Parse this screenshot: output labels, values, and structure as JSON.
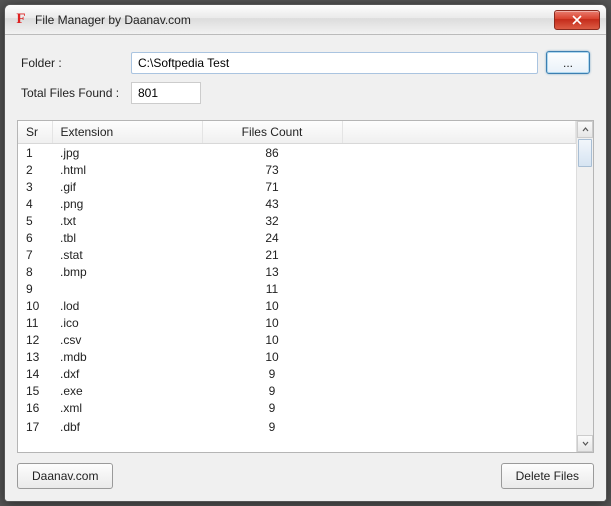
{
  "window": {
    "title": "File Manager by Daanav.com"
  },
  "form": {
    "folder_label": "Folder :",
    "folder_value": "C:\\Softpedia Test",
    "total_label": "Total Files Found :",
    "total_value": "801",
    "browse_label": "..."
  },
  "table": {
    "headers": {
      "sr": "Sr",
      "ext": "Extension",
      "count": "Files Count"
    },
    "rows": [
      {
        "sr": "1",
        "ext": ".jpg",
        "count": "86"
      },
      {
        "sr": "2",
        "ext": ".html",
        "count": "73"
      },
      {
        "sr": "3",
        "ext": ".gif",
        "count": "71"
      },
      {
        "sr": "4",
        "ext": ".png",
        "count": "43"
      },
      {
        "sr": "5",
        "ext": ".txt",
        "count": "32"
      },
      {
        "sr": "6",
        "ext": ".tbl",
        "count": "24"
      },
      {
        "sr": "7",
        "ext": ".stat",
        "count": "21"
      },
      {
        "sr": "8",
        "ext": ".bmp",
        "count": "13"
      },
      {
        "sr": "9",
        "ext": "",
        "count": "11"
      },
      {
        "sr": "10",
        "ext": ".lod",
        "count": "10"
      },
      {
        "sr": "11",
        "ext": ".ico",
        "count": "10"
      },
      {
        "sr": "12",
        "ext": ".csv",
        "count": "10"
      },
      {
        "sr": "13",
        "ext": ".mdb",
        "count": "10"
      },
      {
        "sr": "14",
        "ext": ".dxf",
        "count": "9"
      },
      {
        "sr": "15",
        "ext": ".exe",
        "count": "9"
      },
      {
        "sr": "16",
        "ext": ".xml",
        "count": "9"
      },
      {
        "sr": "17",
        "ext": ".dbf",
        "count": "9"
      }
    ]
  },
  "footer": {
    "daanav_label": "Daanav.com",
    "delete_label": "Delete Files"
  }
}
